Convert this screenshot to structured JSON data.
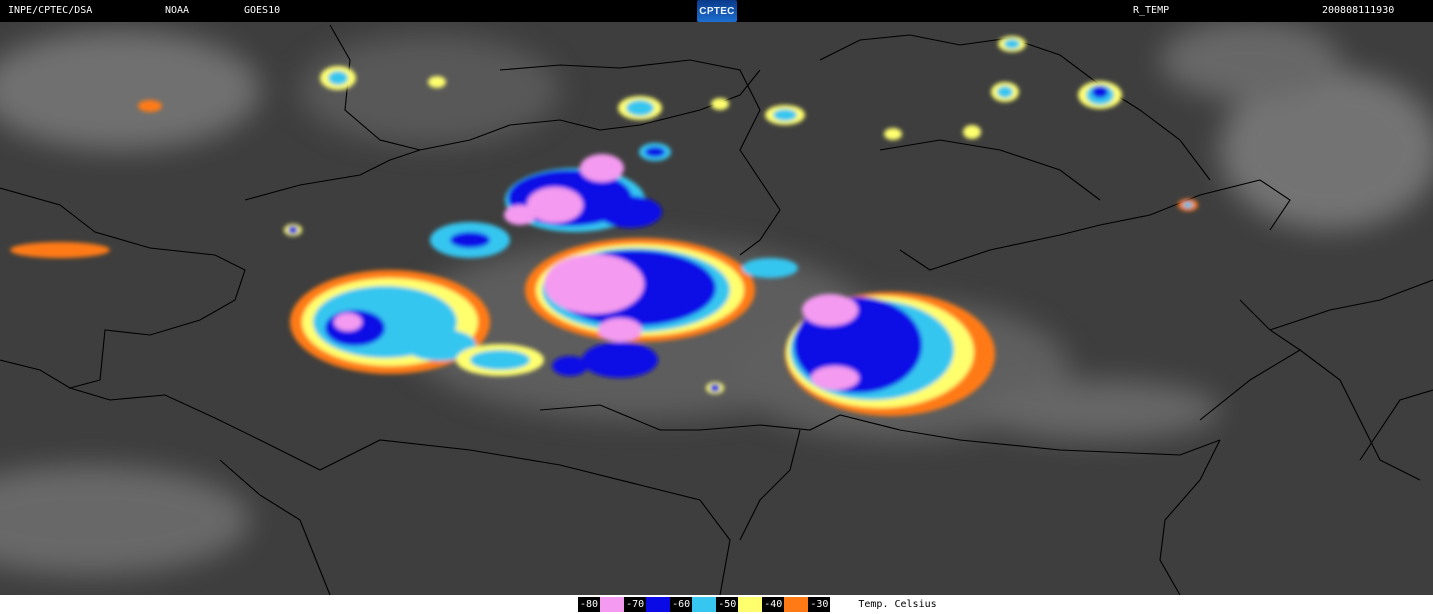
{
  "header": {
    "agency": "INPE/CPTEC/DSA",
    "source": "NOAA",
    "satellite": "GOES10",
    "logo_text": "CPTEC",
    "product": "R_TEMP",
    "timestamp": "200808111930"
  },
  "legend": {
    "items": [
      {
        "label": "-80",
        "color": "#f49af0"
      },
      {
        "label": "-70",
        "color": "#0a0ae6"
      },
      {
        "label": "-60",
        "color": "#36c6f0"
      },
      {
        "label": "-50",
        "color": "#ffff6e"
      },
      {
        "label": "-40",
        "color": "#ff7a14"
      },
      {
        "label": "-30",
        "color": "#ffffff"
      }
    ],
    "unit": "Temp. Celsius"
  },
  "map": {
    "background_color": "#3e3e3e",
    "border_color": "#000000",
    "colors": {
      "m80": "#f49af0",
      "m70": "#0a0ae6",
      "m60": "#36c6f0",
      "m50": "#ffff6e",
      "m40": "#ff7a14"
    }
  }
}
